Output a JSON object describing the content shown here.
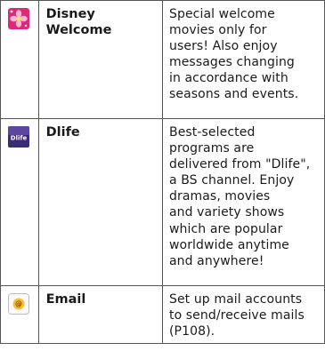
{
  "rows": [
    {
      "icon": "disney-welcome-icon",
      "name": "Disney\nWelcome",
      "description": "Special welcome\nmovies only for\nusers! Also enjoy\nmessages changing\nin accordance with\nseasons and events."
    },
    {
      "icon": "dlife-icon",
      "icon_text": "Dlife",
      "name": "Dlife",
      "description": "Best-selected\nprograms are\ndelivered from \"Dlife\",\na BS channel. Enjoy\ndramas, movies\nand variety shows\nwhich are popular\nworldwide anytime\nand anywhere!"
    },
    {
      "icon": "email-icon",
      "icon_text": "@",
      "name": "Email",
      "description": "Set up mail accounts\nto send/receive mails\n(P108)."
    }
  ],
  "colors": {
    "border": "#555555",
    "disney_icon_bg": "#e0287a",
    "disney_flower": "#f6b8d2",
    "dlife_icon_bg": "#3b2a78",
    "email_badge": "#f2c23a"
  }
}
